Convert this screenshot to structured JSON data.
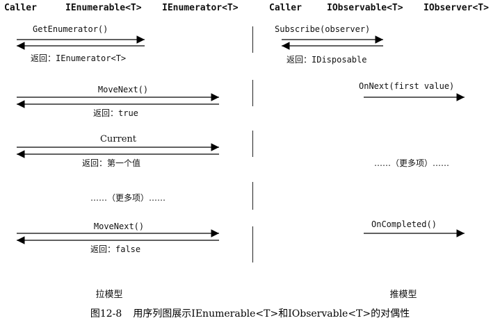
{
  "headers": {
    "pull_caller": "Caller",
    "pull_enumerable": "IEnumerable<T>",
    "pull_enumerator": "IEnumerator<T>",
    "push_caller": "Caller",
    "push_observable": "IObservable<T>",
    "push_observer": "IObserver<T>"
  },
  "pull": {
    "get_enumerator": "GetEnumerator()",
    "return_enumerator": "返回：IEnumerator<T>",
    "movenext_1": "MoveNext()",
    "return_true": "返回：true",
    "current": "Current",
    "return_first": "返回：第一个值",
    "more_items": "……（更多项）……",
    "movenext_2": "MoveNext()",
    "return_false": "返回：false",
    "model_label": "拉模型"
  },
  "push": {
    "subscribe": "Subscribe(observer)",
    "return_disposable": "返回：IDisposable",
    "onnext_first": "OnNext(first value)",
    "more_items": "……（更多项）……",
    "oncompleted": "OnCompleted()",
    "model_label": "推模型"
  },
  "caption": {
    "prefix": "图12-8",
    "text": "用序列图展示IEnumerable<T>和IObservable<T>的对偶性"
  }
}
